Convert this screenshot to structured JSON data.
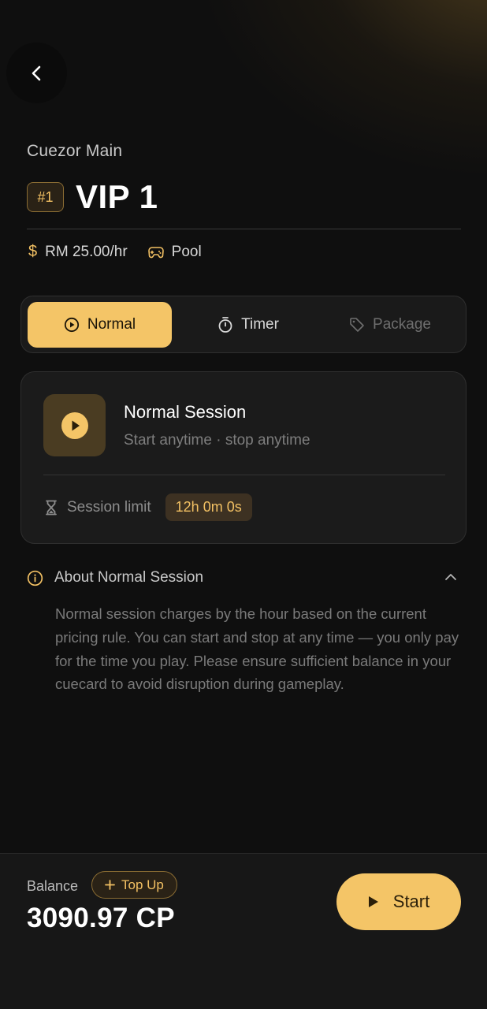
{
  "header": {
    "venue": "Cuezor Main",
    "table_badge": "#1",
    "table_name": "VIP 1"
  },
  "meta": {
    "price_symbol": "$",
    "price": "RM 25.00/hr",
    "game_type": "Pool"
  },
  "tabs": [
    {
      "label": "Normal",
      "icon": "play-circle-icon",
      "active": true
    },
    {
      "label": "Timer",
      "icon": "stopwatch-icon",
      "active": false
    },
    {
      "label": "Package",
      "icon": "tag-icon",
      "active": false,
      "disabled": true
    }
  ],
  "session": {
    "title": "Normal Session",
    "subtitle": "Start anytime · stop anytime",
    "limit_label": "Session limit",
    "limit_value": "12h 0m 0s"
  },
  "about": {
    "title": "About Normal Session",
    "expanded": true,
    "body": "Normal session charges by the hour based on the current pricing rule. You can start and stop at any time — you only pay for the time you play. Please ensure sufficient balance in your cuecard to avoid disruption during gameplay."
  },
  "footer": {
    "balance_label": "Balance",
    "topup_label": "Top Up",
    "topup_icon": "plus-icon",
    "balance_value": "3090.97 CP",
    "start_label": "Start"
  },
  "colors": {
    "accent": "#f4c567",
    "accent_text": "#f2c063",
    "background": "#0f0f0f",
    "card": "#1b1b1b"
  }
}
